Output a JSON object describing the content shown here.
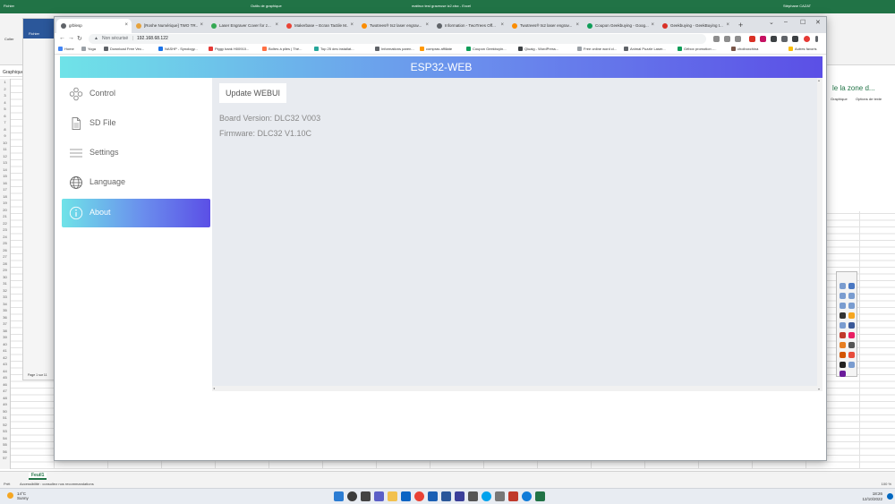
{
  "excel": {
    "ribbon_tab": "Fichier",
    "tool_title": "Outils de graphique",
    "doc_title": "mattrux test graveuse lz2.xlsx  -  Excel",
    "user": "Stéphane CAZAT",
    "paste_label": "Coller",
    "graph_label": "Graphique",
    "sheet_tab": "Feuil1",
    "status_ready": "Prêt",
    "status_accessibility": "Accessibilité : consultez nos recommandations",
    "zoom": "100 %",
    "panel_title": "le la zone d...",
    "panel_tab1": "Graphique",
    "panel_tab2": "Options de texte",
    "inner_ribbon_tab": "Fichier",
    "inner_page": "Page 1 sur 11",
    "row_numbers": [
      "1",
      "2",
      "3",
      "4",
      "5",
      "6",
      "7",
      "8",
      "9",
      "10",
      "11",
      "12",
      "13",
      "14",
      "15",
      "16",
      "17",
      "18",
      "19",
      "20",
      "21",
      "22",
      "23",
      "24",
      "25",
      "26",
      "27",
      "28",
      "29",
      "30",
      "31",
      "32",
      "33",
      "34",
      "35",
      "36",
      "37",
      "38",
      "39",
      "40",
      "41",
      "42",
      "43",
      "44",
      "45",
      "46",
      "47",
      "48",
      "49",
      "50",
      "51",
      "52",
      "53",
      "54",
      "55",
      "56",
      "57"
    ]
  },
  "taskbar": {
    "weather_temp": "14°C",
    "weather_desc": "Sunny",
    "time": "18:26",
    "date": "12/10/2022"
  },
  "browser": {
    "tabs": [
      {
        "label": "grblesp",
        "color": "#5f6368",
        "active": true
      },
      {
        "label": "[Roshe Numérique] TWO TR...",
        "color": "#e6a23c"
      },
      {
        "label": "Laser Engraver Cover for z...",
        "color": "#34a853"
      },
      {
        "label": "Makerbase – Ecran Tactile M...",
        "color": "#ea4335"
      },
      {
        "label": "Twotrees® ts2 laser engrav...",
        "color": "#fb8c00"
      },
      {
        "label": "Information - TwoTrees Off...",
        "color": "#5f6368"
      },
      {
        "label": "Twotrees® ts2 laser engrav...",
        "color": "#fb8c00"
      },
      {
        "label": "Coupon Geekbuying - Goog...",
        "color": "#0f9d58"
      },
      {
        "label": "Geekbuying - GeekBuying t...",
        "color": "#d93025"
      }
    ],
    "new_tab": "+",
    "security": "Non sécurisé",
    "url": "192.168.68.122",
    "bookmarks": [
      {
        "label": "Home",
        "color": "#4285f4"
      },
      {
        "label": "Yoga",
        "color": "#9aa0a6"
      },
      {
        "label": "Download Free Vec...",
        "color": "#5f6368"
      },
      {
        "label": "NASHP - Synology...",
        "color": "#1a73e8"
      },
      {
        "label": "Piggy bank H00910...",
        "color": "#e53935"
      },
      {
        "label": "Boîtes à piles | Thé...",
        "color": "#ff7043"
      },
      {
        "label": "Top 25 des installat...",
        "color": "#26a69a"
      },
      {
        "label": "Informations paren...",
        "color": "#5f6368"
      },
      {
        "label": "compras affiliate",
        "color": "#ff9800"
      },
      {
        "label": "Coupon Geekbuyin...",
        "color": "#0f9d58"
      },
      {
        "label": "Qiuaig - WordPress...",
        "color": "#3c4043"
      },
      {
        "label": "Free online word cl...",
        "color": "#9aa0a6"
      },
      {
        "label": "Animal Puzzle Laser...",
        "color": "#5f6368"
      },
      {
        "label": "Gêbox promotion -...",
        "color": "#0f9d58"
      },
      {
        "label": "choiboxchina",
        "color": "#795548"
      },
      {
        "label": "Autres favoris",
        "color": "#fbbc04"
      }
    ]
  },
  "app": {
    "title": "ESP32-WEB",
    "nav": [
      {
        "label": "Control",
        "icon": "gamepad-icon",
        "active": false
      },
      {
        "label": "SD File",
        "icon": "file-icon",
        "active": false
      },
      {
        "label": "Settings",
        "icon": "menu-lines-icon",
        "active": false
      },
      {
        "label": "Language",
        "icon": "globe-icon",
        "active": false
      },
      {
        "label": "About",
        "icon": "info-icon",
        "active": true
      }
    ],
    "update_button": "Update WEBUI",
    "board_version": "Board Version: DLC32 V003",
    "firmware": "Firmware: DLC32 V1.10C"
  },
  "colors": {
    "excel_green": "#217346",
    "gradient_start": "#6fe3e8",
    "gradient_end": "#5b4fe6",
    "main_bg": "#e8ebf0"
  }
}
